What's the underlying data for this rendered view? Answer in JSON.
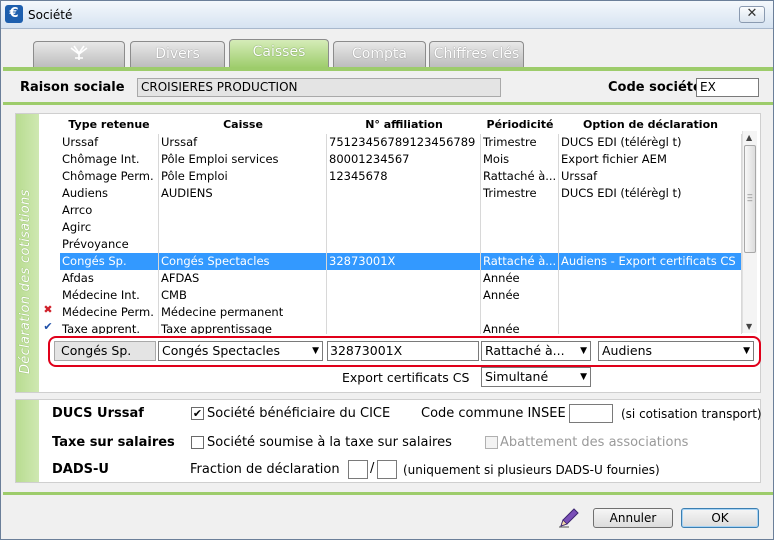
{
  "window": {
    "title": "Société",
    "app_icon_glyph": "€",
    "close_glyph": "✕"
  },
  "tabs": [
    {
      "label": "",
      "icon": "wings-logo-icon"
    },
    {
      "label": "Divers"
    },
    {
      "label": "Caisses",
      "active": true
    },
    {
      "label": "Compta"
    },
    {
      "label": "Chiffres clés"
    }
  ],
  "header": {
    "raison_sociale_label": "Raison sociale",
    "raison_sociale_value": "CROISIERES PRODUCTION",
    "code_societe_label": "Code société",
    "code_societe_value": "EX"
  },
  "cotisations": {
    "section_label": "Déclaration des cotisations",
    "columns": [
      "Type retenue",
      "Caisse",
      "N° affiliation",
      "Périodicité",
      "Option de déclaration"
    ],
    "rows": [
      {
        "type": "Urssaf",
        "caisse": "Urssaf",
        "affiliation": "75123456789123456789",
        "periodicite": "Trimestre",
        "option": "DUCS EDI (télérègl t)",
        "mark": ""
      },
      {
        "type": "Chômage Int.",
        "caisse": "Pôle Emploi services",
        "affiliation": "80001234567",
        "periodicite": "Mois",
        "option": "Export fichier AEM",
        "mark": ""
      },
      {
        "type": "Chômage Perm.",
        "caisse": "Pôle Emploi",
        "affiliation": "12345678",
        "periodicite": "Rattaché à...",
        "option": "Urssaf",
        "mark": ""
      },
      {
        "type": "Audiens",
        "caisse": "AUDIENS",
        "affiliation": "",
        "periodicite": "Trimestre",
        "option": "DUCS EDI (télérègl t)",
        "mark": ""
      },
      {
        "type": "Arrco",
        "caisse": "",
        "affiliation": "",
        "periodicite": "",
        "option": "",
        "mark": ""
      },
      {
        "type": "Agirc",
        "caisse": "",
        "affiliation": "",
        "periodicite": "",
        "option": "",
        "mark": ""
      },
      {
        "type": "Prévoyance",
        "caisse": "",
        "affiliation": "",
        "periodicite": "",
        "option": "",
        "mark": ""
      },
      {
        "type": "Congés Sp.",
        "caisse": "Congés Spectacles",
        "affiliation": "32873001X",
        "periodicite": "Rattaché à...",
        "option": "Audiens - Export certificats CS",
        "mark": "",
        "selected": true
      },
      {
        "type": "Afdas",
        "caisse": "AFDAS",
        "affiliation": "",
        "periodicite": "Année",
        "option": "",
        "mark": ""
      },
      {
        "type": "Médecine Int.",
        "caisse": "CMB",
        "affiliation": "",
        "periodicite": "Année",
        "option": "",
        "mark": ""
      },
      {
        "type": "Médecine Perm.",
        "caisse": "Médecine permanent",
        "affiliation": "",
        "periodicite": "",
        "option": "",
        "mark": "✖"
      },
      {
        "type": "Taxe apprent.",
        "caisse": "Taxe apprentissage",
        "affiliation": "",
        "periodicite": "Année",
        "option": "",
        "mark": "✔"
      }
    ],
    "edit": {
      "type": "Congés Sp.",
      "caisse": "Congés Spectacles",
      "affiliation": "32873001X",
      "periodicite": "Rattaché à...",
      "option": "Audiens"
    },
    "export_label": "Export certificats CS",
    "export_value": "Simultané"
  },
  "options": {
    "ducs_label": "DUCS Urssaf",
    "cice_label": "Société bénéficiaire du CICE",
    "cice_checked": true,
    "insee_label": "Code commune INSEE",
    "insee_value": "",
    "insee_hint": "(si cotisation transport)",
    "taxe_label": "Taxe sur salaires",
    "taxe_cb_label": "Société soumise à la taxe sur salaires",
    "taxe_checked": false,
    "abattement_label": "Abattement des associations",
    "dadsu_label": "DADS-U",
    "fraction_label": "Fraction de déclaration",
    "fraction_num": "",
    "fraction_sep": "/",
    "fraction_den": "",
    "fraction_hint": "(uniquement si plusieurs DADS-U fournies)"
  },
  "footer": {
    "cancel_label": "Annuler",
    "ok_label": "OK"
  },
  "colors": {
    "accent_green": "#9dcc6b",
    "selection_blue": "#3399ff",
    "highlight_red": "#e0001a"
  }
}
